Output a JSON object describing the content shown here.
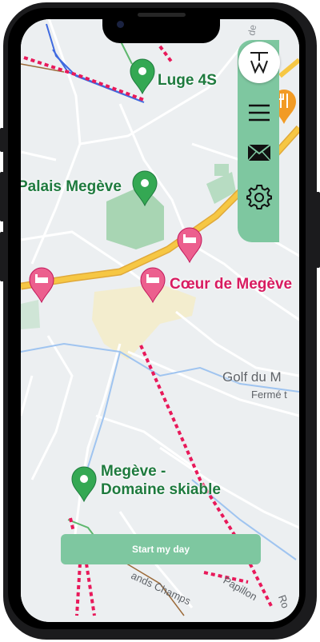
{
  "map": {
    "places": {
      "luge": "Luge 4S",
      "palais": "Palais Megève",
      "coeur": "Cœur de Megève",
      "golf": "Golf du M",
      "golf_status": "Fermé t",
      "domaine_line1": "Megève -",
      "domaine_line2": "Domaine skiable"
    },
    "roads": {
      "champs": "ands Champs",
      "papillon": "Papillon",
      "edge": "Ro"
    }
  },
  "sidebar": {
    "logo_text": "TW",
    "icons": [
      "menu-icon",
      "mail-icon",
      "settings-icon"
    ]
  },
  "cta": {
    "label": "Start my day"
  },
  "colors": {
    "accent": "#7ec7a0",
    "place_green": "#1e7a3e",
    "hotel_pink": "#d81b60",
    "highway": "#f6c744",
    "ski_trail": "#e8195a"
  }
}
